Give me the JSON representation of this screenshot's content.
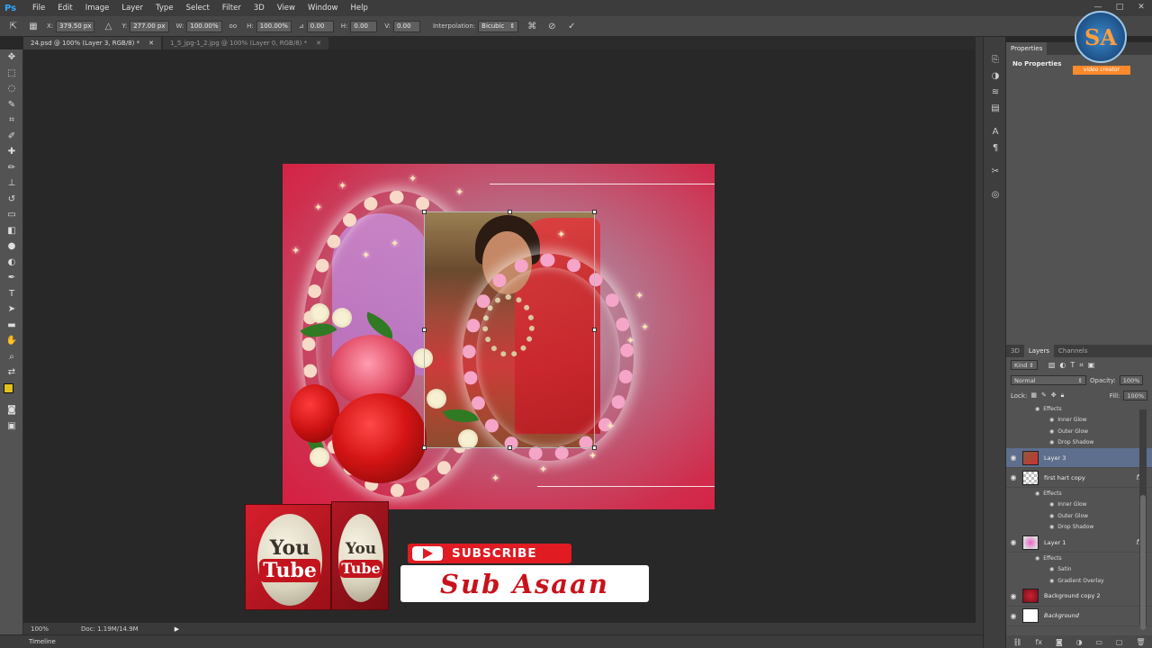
{
  "app": {
    "logo": "Ps"
  },
  "menu": [
    "File",
    "Edit",
    "Image",
    "Layer",
    "Type",
    "Select",
    "Filter",
    "3D",
    "View",
    "Window",
    "Help"
  ],
  "window_controls": [
    "—",
    "□",
    "✕"
  ],
  "options": {
    "x_label": "X:",
    "x_value": "379.50 px",
    "y_label": "Y:",
    "y_value": "277.00 px",
    "w_label": "W:",
    "w_value": "100.00%",
    "link_label": "oo",
    "h_label": "H:",
    "h_value": "100.00%",
    "angle_value": "0.00",
    "hskew_label": "H:",
    "hskew_value": "0.00",
    "vskew_label": "V:",
    "vskew_value": "0.00",
    "interp_label": "Interpolation:",
    "interp_value": "Bicubic"
  },
  "tabs": [
    {
      "label": "24.psd @ 100% (Layer 3, RGB/8) *"
    },
    {
      "label": "1_5_jpg-1_2.jpg @ 100% (Layer 0, RGB/8) *"
    }
  ],
  "canvas": {
    "subscribe": "SUBSCRIBE",
    "channel": "Sub Asaan",
    "yt_you": "You",
    "yt_tube": "Tube"
  },
  "status": {
    "zoom": "100%",
    "doc": "Doc: 1.19M/14.9M"
  },
  "timeline": {
    "label": "Timeline"
  },
  "properties": {
    "tab": "Properties",
    "empty": "No Properties"
  },
  "layers_panel": {
    "tabs": [
      "3D",
      "Layers",
      "Channels"
    ],
    "kind": "Kind",
    "blend": "Normal",
    "opacity_label": "Opacity:",
    "opacity": "100%",
    "lock_label": "Lock:",
    "fill_label": "Fill:",
    "fill": "100%",
    "top_effects": [
      "Effects",
      "Inner Glow",
      "Outer Glow",
      "Drop Shadow"
    ],
    "layer3": "Layer 3",
    "first_hart": "first hart copy",
    "first_effects": [
      "Effects",
      "Inner Glow",
      "Outer Glow",
      "Drop Shadow"
    ],
    "layer1": "Layer 1",
    "layer1_effects": [
      "Effects",
      "Satin",
      "Gradient Overlay"
    ],
    "bg_copy": "Background copy 2",
    "background": "Background"
  },
  "watermark": {
    "initials": "SA",
    "caption": "video creator"
  },
  "colors": {
    "foreground": "#e2c21a",
    "background": "#ffffff",
    "accent": "#31a8ff"
  }
}
